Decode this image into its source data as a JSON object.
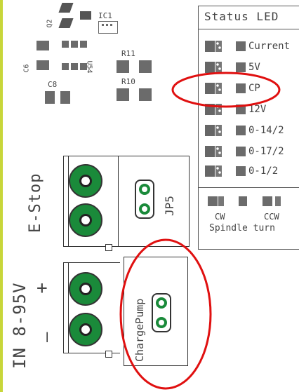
{
  "board_labels": {
    "q2": "Q2",
    "ic1": "IC1",
    "c6": "C6",
    "c8": "C8",
    "u54": "U54",
    "r11": "R11",
    "r10": "R10",
    "jp5": "JP5",
    "estop": "E-Stop",
    "power_in": "IN 8-95V",
    "plus": "+",
    "minus": "—",
    "chargepump": "ChargePump"
  },
  "status_led": {
    "title": "Status LED",
    "rows": [
      "Current",
      "5V",
      "CP",
      "12V",
      "0-14/2",
      "0-17/2",
      "0-1/2"
    ],
    "spindle": {
      "cw": "CW",
      "ccw": "CCW",
      "caption": "Spindle turn"
    }
  },
  "colors": {
    "background": "#ffffff",
    "pcb_edge": "#c8d63a",
    "pad": "#6b6b6b",
    "terminal_screw": "#1a8a3a",
    "highlight": "#e01010"
  }
}
